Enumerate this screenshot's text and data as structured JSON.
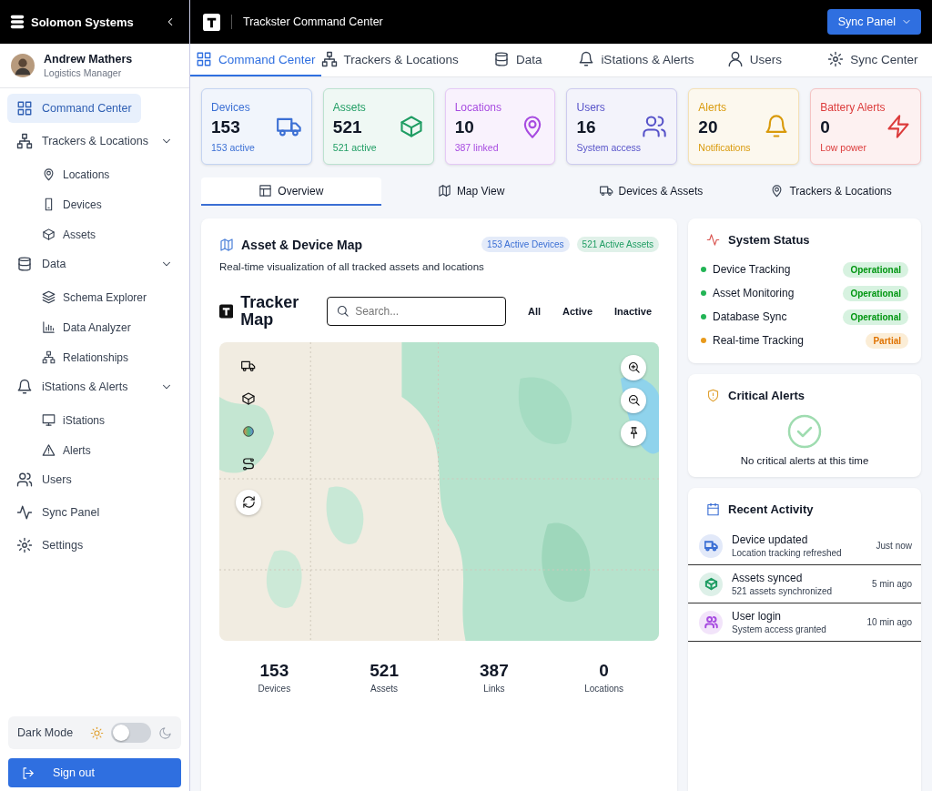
{
  "sidebar": {
    "brand": "Solomon Systems",
    "user": {
      "name": "Andrew Mathers",
      "role": "Logistics Manager"
    },
    "nav": [
      {
        "label": "Command Center",
        "selected": true
      },
      {
        "label": "Trackers & Locations",
        "selected": false,
        "expanded": true,
        "children": [
          {
            "label": "Locations",
            "selected": false
          },
          {
            "label": "Devices",
            "selected": false
          },
          {
            "label": "Assets",
            "selected": false
          }
        ]
      },
      {
        "label": "Data",
        "selected": false,
        "expanded": true,
        "children": [
          {
            "label": "Schema Explorer",
            "selected": false
          },
          {
            "label": "Data Analyzer",
            "selected": false
          },
          {
            "label": "Relationships",
            "selected": false
          }
        ]
      },
      {
        "label": "iStations & Alerts",
        "selected": false,
        "expanded": true,
        "children": [
          {
            "label": "iStations",
            "selected": false
          },
          {
            "label": "Alerts",
            "selected": false
          }
        ]
      },
      {
        "label": "Users",
        "selected": false
      },
      {
        "label": "Sync Panel",
        "selected": false
      },
      {
        "label": "Settings",
        "selected": false
      }
    ],
    "dark_mode": {
      "label": "Dark Mode",
      "on": false
    },
    "sign_out": "Sign out"
  },
  "header": {
    "title": "Trackster Command Center",
    "button": "Sync Panel"
  },
  "tabs": [
    {
      "label": "Command Center",
      "selected": true
    },
    {
      "label": "Trackers & Locations",
      "selected": false
    },
    {
      "label": "Data",
      "selected": false
    },
    {
      "label": "iStations & Alerts",
      "selected": false
    },
    {
      "label": "Users",
      "selected": false
    },
    {
      "label": "Sync Center",
      "selected": false
    }
  ],
  "stats": [
    {
      "label": "Devices",
      "value": "153",
      "sub": "153 active",
      "color": "#3b6fd4"
    },
    {
      "label": "Assets",
      "value": "521",
      "sub": "521 active",
      "color": "#1f9d63"
    },
    {
      "label": "Locations",
      "value": "10",
      "sub": "387 linked",
      "color": "#a74be0"
    },
    {
      "label": "Users",
      "value": "16",
      "sub": "System access",
      "color": "#5753c9"
    },
    {
      "label": "Alerts",
      "value": "20",
      "sub": "Notifications",
      "color": "#d99a0b"
    },
    {
      "label": "Battery Alerts",
      "value": "0",
      "sub": "Low power",
      "color": "#dc3b3b"
    }
  ],
  "subtabs": [
    {
      "label": "Overview",
      "selected": true
    },
    {
      "label": "Map View",
      "selected": false
    },
    {
      "label": "Devices & Assets",
      "selected": false
    },
    {
      "label": "Trackers & Locations",
      "selected": false
    }
  ],
  "map_card": {
    "title": "Asset & Device Map",
    "badges": [
      {
        "label": "153 Active Devices",
        "color": "#3b6fd4"
      },
      {
        "label": "521 Active Assets",
        "color": "#1f9d63"
      }
    ],
    "subtitle": "Real-time visualization of all tracked assets and locations",
    "tracker_title": "Tracker Map",
    "search": {
      "placeholder": "Search..."
    },
    "filters": [
      "All",
      "Active",
      "Inactive"
    ],
    "totals": [
      {
        "value": "153",
        "label": "Devices"
      },
      {
        "value": "521",
        "label": "Assets"
      },
      {
        "value": "387",
        "label": "Links"
      },
      {
        "value": "0",
        "label": "Locations"
      }
    ]
  },
  "system_status": {
    "title": "System Status",
    "items": [
      {
        "name": "Device Tracking",
        "status": "Operational",
        "color": "#22b455"
      },
      {
        "name": "Asset Monitoring",
        "status": "Operational",
        "color": "#22b455"
      },
      {
        "name": "Database Sync",
        "status": "Operational",
        "color": "#22b455"
      },
      {
        "name": "Real-time Tracking",
        "status": "Partial",
        "color": "#e89a1c"
      }
    ]
  },
  "critical_alerts": {
    "title": "Critical Alerts",
    "message": "No critical alerts at this time"
  },
  "recent_activity": {
    "title": "Recent Activity",
    "items": [
      {
        "title": "Device updated",
        "detail": "Location tracking refreshed",
        "time": "Just now",
        "color": "#3b6fd4"
      },
      {
        "title": "Assets synced",
        "detail": "521 assets synchronized",
        "time": "5 min ago",
        "color": "#1f9d63"
      },
      {
        "title": "User login",
        "detail": "System access granted",
        "time": "10 min ago",
        "color": "#a74be0"
      }
    ]
  }
}
